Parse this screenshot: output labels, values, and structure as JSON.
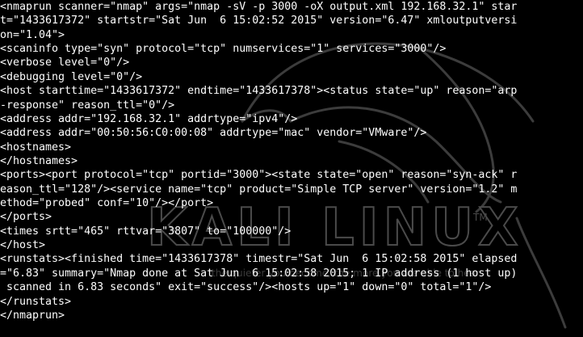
{
  "watermark": {
    "logo_text": "KALI LINUX",
    "trademark": "TM",
    "tagline": "the quieter you become, the more you are able to hear"
  },
  "terminal": {
    "lines": [
      "<nmaprun scanner=\"nmap\" args=\"nmap -sV -p 3000 -oX output.xml 192.168.32.1\" star",
      "t=\"1433617372\" startstr=\"Sat Jun  6 15:02:52 2015\" version=\"6.47\" xmloutputversi",
      "on=\"1.04\">",
      "<scaninfo type=\"syn\" protocol=\"tcp\" numservices=\"1\" services=\"3000\"/>",
      "<verbose level=\"0\"/>",
      "<debugging level=\"0\"/>",
      "<host starttime=\"1433617372\" endtime=\"1433617378\"><status state=\"up\" reason=\"arp",
      "-response\" reason_ttl=\"0\"/>",
      "<address addr=\"192.168.32.1\" addrtype=\"ipv4\"/>",
      "<address addr=\"00:50:56:C0:00:08\" addrtype=\"mac\" vendor=\"VMware\"/>",
      "<hostnames>",
      "</hostnames>",
      "<ports><port protocol=\"tcp\" portid=\"3000\"><state state=\"open\" reason=\"syn-ack\" r",
      "eason_ttl=\"128\"/><service name=\"tcp\" product=\"Simple TCP server\" version=\"1.2\" m",
      "ethod=\"probed\" conf=\"10\"/></port>",
      "</ports>",
      "<times srtt=\"465\" rttvar=\"3807\" to=\"100000\"/>",
      "</host>",
      "<runstats><finished time=\"1433617378\" timestr=\"Sat Jun  6 15:02:58 2015\" elapsed",
      "=\"6.83\" summary=\"Nmap done at Sat Jun  6 15:02:58 2015; 1 IP address (1 host up)",
      " scanned in 6.83 seconds\" exit=\"success\"/><hosts up=\"1\" down=\"0\" total=\"1\"/>",
      "</runstats>",
      "</nmaprun>"
    ]
  }
}
